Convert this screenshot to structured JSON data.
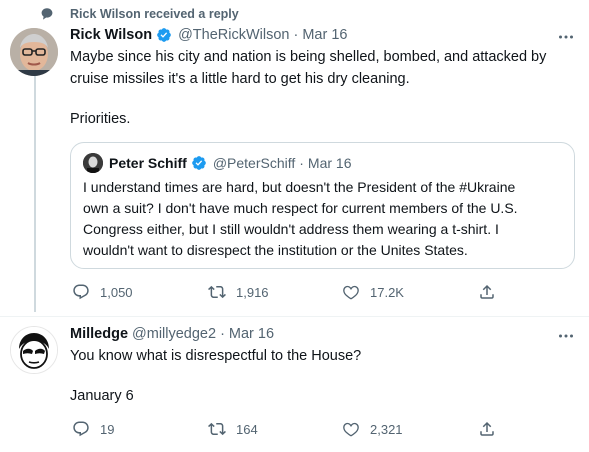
{
  "context": {
    "text": "Rick Wilson received a reply",
    "icon": "speech-bubble-icon"
  },
  "tweet1": {
    "name": "Rick Wilson",
    "handle": "@TheRickWilson",
    "dot": "·",
    "date": "Mar 16",
    "line1": "Maybe since his city and nation  is being shelled, bombed, and attacked by",
    "line2": "cruise missiles it's a little hard to get his dry cleaning.",
    "line3": "Priorities.",
    "replies": "1,050",
    "retweets": "1,916",
    "likes": "17.2K"
  },
  "quote": {
    "name": "Peter Schiff",
    "handle": "@PeterSchiff",
    "dot": "·",
    "date": "Mar 16",
    "line1": "I understand times are hard, but doesn't the President of the #Ukraine",
    "line2": "own a suit? I don't have much respect for current members of the U.S.",
    "line3": "Congress either, but I still wouldn't address them wearing a t-shirt. I",
    "line4": "wouldn't want to disrespect the institution or the Unites States."
  },
  "tweet2": {
    "name": "Milledge",
    "handle": "@millyedge2",
    "dot": "·",
    "date": "Mar 16",
    "line1": "You know what is disrespectful to the House?",
    "line2": "January 6",
    "replies": "19",
    "retweets": "164",
    "likes": "2,321"
  },
  "colors": {
    "accent": "#1d9bf0",
    "muted": "#536471",
    "text": "#0f1419",
    "border": "#cfd9de"
  }
}
